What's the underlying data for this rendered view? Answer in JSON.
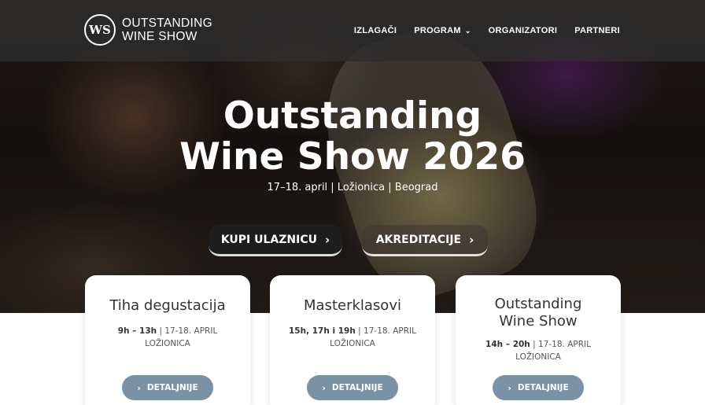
{
  "logo": {
    "mark": "WS",
    "line1": "OUTSTANDING",
    "line2": "WINE SHOW"
  },
  "nav": {
    "items": [
      {
        "label": "IZLAGAČI"
      },
      {
        "label": "PROGRAM",
        "dropdown": true
      },
      {
        "label": "ORGANIZATORI"
      },
      {
        "label": "PARTNERI"
      }
    ]
  },
  "hero": {
    "title_line1": "Outstanding",
    "title_line2": "Wine Show 2026",
    "subtitle": "17–18. april | Ložionica | Beograd",
    "primary_button": "KUPI ULAZNICU",
    "secondary_button": "AKREDITACIJE"
  },
  "cards": [
    {
      "title": "Tiha degustacija",
      "time": "9h – 13h",
      "date": " | 17-18. APRIL",
      "place": "LOŽIONICA",
      "button": "DETALJNIJE"
    },
    {
      "title": "Masterklasovi",
      "time": "15h, 17h i 19h",
      "date": " | 17-18. APRIL",
      "place": "LOŽIONICA",
      "button": "DETALJNIJE"
    },
    {
      "title_line1": "Outstanding",
      "title_line2": "Wine Show",
      "time": "14h – 20h",
      "date": " | 17-18. APRIL",
      "place": "LOŽIONICA",
      "button": "DETALJNIJE"
    }
  ],
  "icons": {
    "chevron": "›",
    "dropdown": "⌄"
  }
}
